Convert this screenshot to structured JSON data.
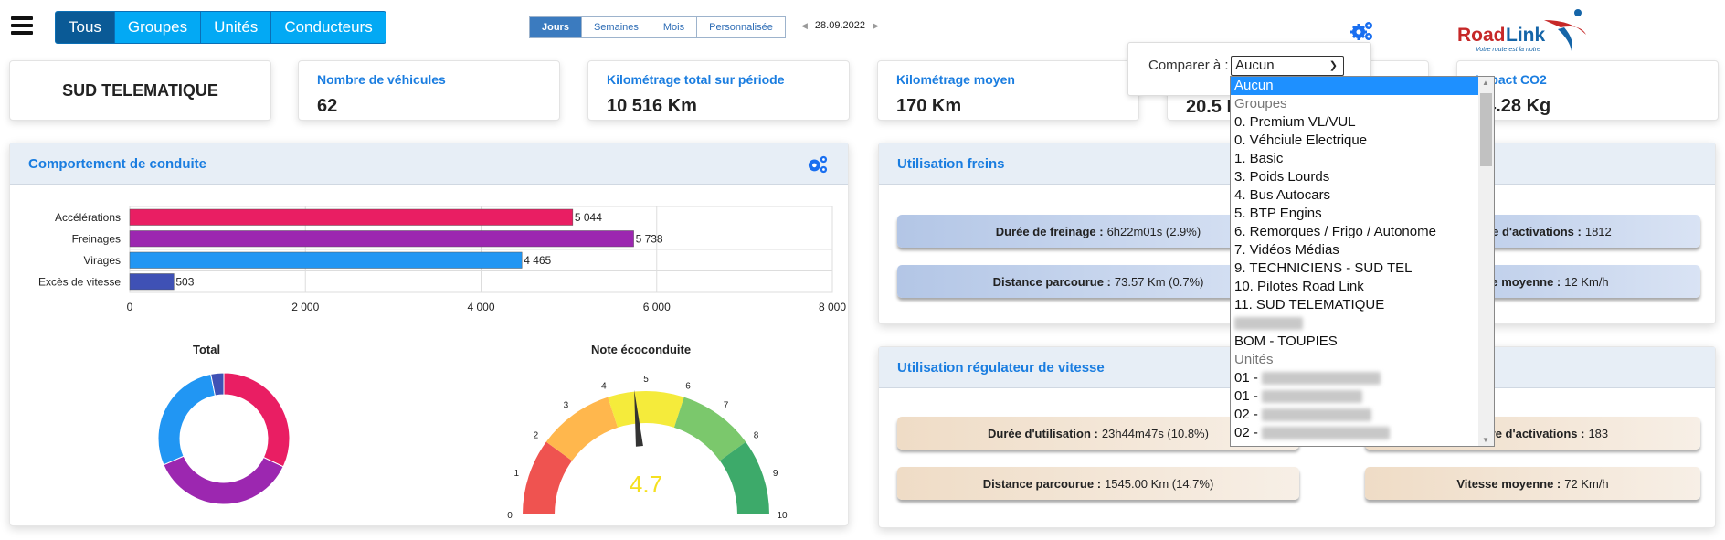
{
  "nav": {
    "tabs": [
      "Tous",
      "Groupes",
      "Unités",
      "Conducteurs"
    ],
    "active": 0
  },
  "period": {
    "tabs": [
      "Jours",
      "Semaines",
      "Mois",
      "Personnalisée"
    ],
    "active": 0,
    "date": "28.09.2022",
    "prev": "◀",
    "next": "▶"
  },
  "logo": {
    "brand": "RoadLink",
    "tagline": "Votre route est la notre"
  },
  "cards": [
    {
      "title": "SUD TELEMATIQUE"
    },
    {
      "label": "Nombre de véhicules",
      "value": "62"
    },
    {
      "label": "Kilométrage total sur période",
      "value": "10 516 Km"
    },
    {
      "label": "Kilométrage moyen",
      "value": "170 Km"
    },
    {
      "label": "",
      "value": "20.5 L"
    },
    {
      "label": "Impact CO2",
      "value": "44.28 Kg"
    }
  ],
  "compare": {
    "label": "Comparer à :",
    "value": "Aucun",
    "options": [
      {
        "text": "Aucun",
        "type": "selected"
      },
      {
        "text": "Groupes",
        "type": "group"
      },
      {
        "text": "0. Premium VL/VUL"
      },
      {
        "text": "0. Véhciule Electrique"
      },
      {
        "text": "1. Basic"
      },
      {
        "text": "3. Poids Lourds"
      },
      {
        "text": "4. Bus Autocars"
      },
      {
        "text": "5. BTP Engins"
      },
      {
        "text": "6. Remorques / Frigo / Autonome"
      },
      {
        "text": "7. Vidéos Médias"
      },
      {
        "text": "9. TECHNICIENS - SUD TEL"
      },
      {
        "text": "10. Pilotes Road Link"
      },
      {
        "text": "11. SUD TELEMATIQUE"
      },
      {
        "text": "",
        "type": "blurred"
      },
      {
        "text": "BOM - TOUPIES"
      },
      {
        "text": "Unités",
        "type": "group"
      },
      {
        "text": "01 - ",
        "type": "partial"
      },
      {
        "text": "01 - ",
        "type": "partial"
      },
      {
        "text": "02 - ",
        "type": "partial"
      },
      {
        "text": "02 - ",
        "type": "partial"
      }
    ]
  },
  "driving": {
    "title": "Comportement de conduite",
    "total_title": "Total",
    "eco_title": "Note écoconduite"
  },
  "chart_data": [
    {
      "type": "bar",
      "orientation": "horizontal",
      "categories": [
        "Accélérations",
        "Freinages",
        "Virages",
        "Excès de vitesse"
      ],
      "values": [
        5044,
        5738,
        4465,
        503
      ],
      "value_labels": [
        "5 044",
        "5 738",
        "4 465",
        "503"
      ],
      "colors": [
        "#e91e63",
        "#9c27b0",
        "#2196f3",
        "#3f51b5"
      ],
      "xlim": [
        0,
        8000
      ],
      "xticks": [
        0,
        2000,
        4000,
        6000,
        8000
      ],
      "xtick_labels": [
        "0",
        "2 000",
        "4 000",
        "6 000",
        "8 000"
      ],
      "grid": true
    },
    {
      "type": "pie",
      "donut": true,
      "title": "Total",
      "categories": [
        "Accélérations",
        "Freinages",
        "Virages",
        "Excès de vitesse"
      ],
      "values": [
        5044,
        5738,
        4465,
        503
      ],
      "colors": [
        "#e91e63",
        "#9c27b0",
        "#2196f3",
        "#3f51b5"
      ]
    },
    {
      "type": "gauge",
      "title": "Note écoconduite",
      "value": 4.7,
      "value_label": "4.7",
      "range": [
        0,
        10
      ],
      "ticks": [
        "0",
        "1",
        "2",
        "3",
        "4",
        "5",
        "6",
        "7",
        "8",
        "9",
        "10"
      ],
      "bands": [
        {
          "from": 0,
          "to": 2,
          "color": "#ef5350"
        },
        {
          "from": 2,
          "to": 4,
          "color": "#ffb74d"
        },
        {
          "from": 4,
          "to": 6,
          "color": "#f5eb3b"
        },
        {
          "from": 6,
          "to": 8,
          "color": "#7bc86c"
        },
        {
          "from": 8,
          "to": 10,
          "color": "#3daa6a"
        }
      ],
      "value_color": "#f5e020"
    }
  ],
  "brakes": {
    "title": "Utilisation freins",
    "items": [
      {
        "label": "Durée de freinage :",
        "value": "6h22m01s (2.9%)"
      },
      {
        "label": "Nombre d'activations :",
        "value": "1812"
      },
      {
        "label": "Distance parcourue :",
        "value": "73.57 Km (0.7%)"
      },
      {
        "label": "Vitesse moyenne :",
        "value": "12 Km/h"
      }
    ]
  },
  "cruise": {
    "title": "Utilisation régulateur de vitesse",
    "items": [
      {
        "label": "Durée d'utilisation :",
        "value": "23h44m47s (10.8%)"
      },
      {
        "label": "Nombre d'activations :",
        "value": "183"
      },
      {
        "label": "Distance parcourue :",
        "value": "1545.00 Km (14.7%)"
      },
      {
        "label": "Vitesse moyenne :",
        "value": "72 Km/h"
      }
    ]
  },
  "colors": {
    "accent": "#1a7de0",
    "nav": "#03a9f4",
    "nav_active": "#0a5a96"
  }
}
